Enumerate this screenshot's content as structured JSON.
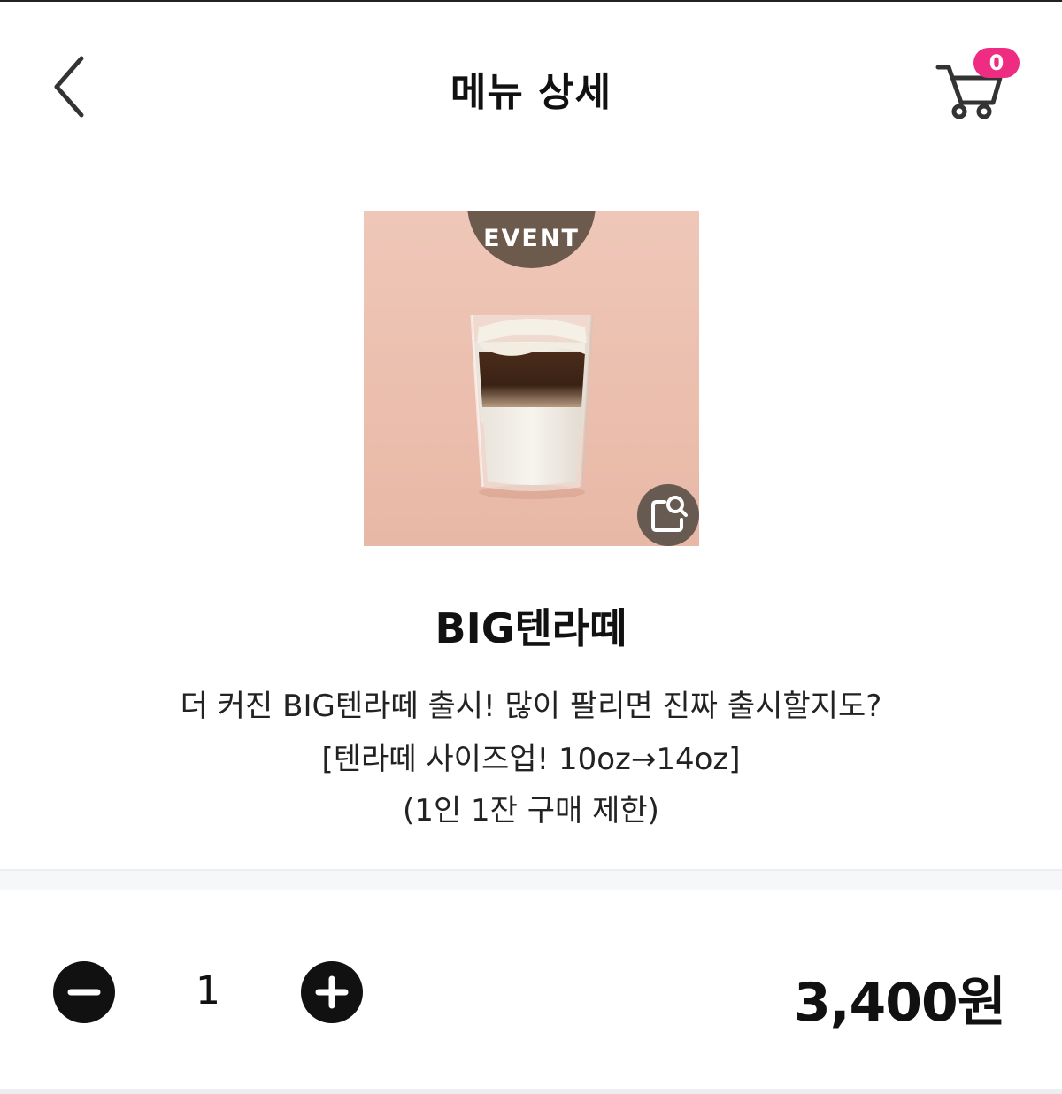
{
  "header": {
    "title": "메뉴 상세",
    "back_icon": "chevron-left-icon",
    "cart_icon": "shopping-cart-icon",
    "cart_count": "0"
  },
  "product": {
    "badge": "EVENT",
    "image": "iced-layered-latte-glass",
    "zoom_icon": "image-zoom-icon",
    "name": "BIG텐라떼",
    "description": [
      "더 커진 BIG텐라떼 출시! 많이 팔리면 진짜 출시할지도?",
      "[텐라떼 사이즈업! 10oz→14oz]",
      "(1인 1잔 구매 제한)"
    ]
  },
  "order": {
    "minus_icon": "minus-circle-icon",
    "plus_icon": "plus-circle-icon",
    "quantity": "1",
    "price": "3,400원"
  },
  "colors": {
    "badge_pink": "#ee2c82",
    "event_brown": "#6c5a4d",
    "image_bg": "#edc3b3",
    "text": "#111111"
  }
}
